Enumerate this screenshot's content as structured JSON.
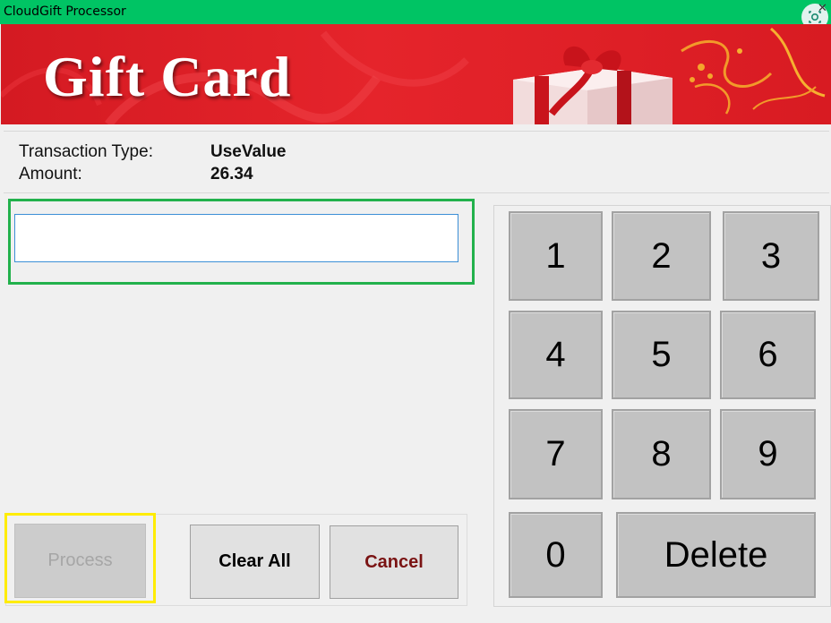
{
  "window": {
    "title": "CloudGift Processor"
  },
  "banner": {
    "title": "Gift Card"
  },
  "transaction": {
    "type_label": "Transaction Type:",
    "type_value": "UseValue",
    "amount_label": "Amount:",
    "amount_value": "26.34"
  },
  "card_input": {
    "value": "",
    "placeholder": ""
  },
  "actions": {
    "process": "Process",
    "clear_all": "Clear All",
    "cancel": "Cancel"
  },
  "keypad": {
    "keys": [
      "1",
      "2",
      "3",
      "4",
      "5",
      "6",
      "7",
      "8",
      "9",
      "0"
    ],
    "delete": "Delete"
  },
  "colors": {
    "title_bar": "#00c464",
    "banner_red": "#e5242b",
    "input_highlight": "#22b14c",
    "process_highlight": "#ffec00",
    "cancel_text": "#7a1313",
    "key_face": "#c2c2c2"
  }
}
